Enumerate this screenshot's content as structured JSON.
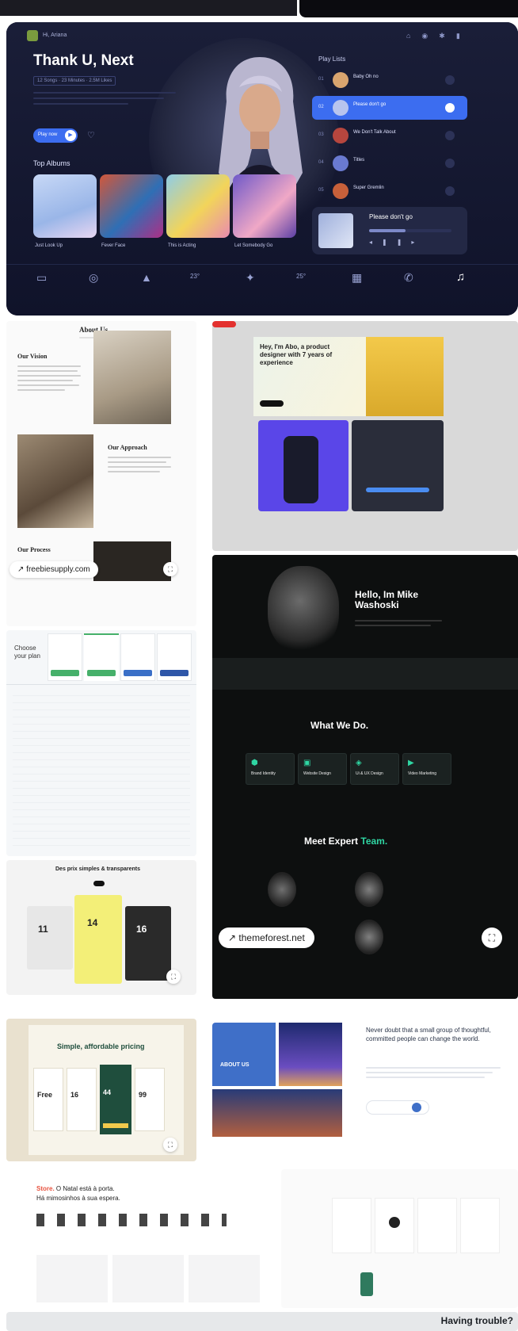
{
  "music": {
    "user_label": "Hi, Ariana",
    "title": "Thank U, Next",
    "meta": "12 Songs · 23 Minutes · 2.5M Likes",
    "play_label": "Play now",
    "top_albums_label": "Top Albums",
    "albums": [
      {
        "name": "Just Look Up"
      },
      {
        "name": "Fever Face"
      },
      {
        "name": "This is Acting"
      },
      {
        "name": "Let Somebody Go"
      }
    ],
    "playlists_label": "Play Lists",
    "playlist": [
      {
        "n": "01",
        "title": "Baby Oh no"
      },
      {
        "n": "02",
        "title": "Please don't go"
      },
      {
        "n": "03",
        "title": "We Don't Talk About"
      },
      {
        "n": "04",
        "title": "Titles"
      },
      {
        "n": "05",
        "title": "Super Gremlin"
      }
    ],
    "now_playing": "Please don't go",
    "temp_left": "23°",
    "temp_right": "25°"
  },
  "about": {
    "title": "About Us",
    "vision": "Our Vision",
    "approach": "Our Approach",
    "process": "Our Process",
    "source": "freebiesupply.com"
  },
  "pricing_table": {
    "heading": "Choose your plan"
  },
  "portfolio": {
    "headline": "Hey, I'm Abo, a product designer with 7 years of experience"
  },
  "agency": {
    "hello": "Hello, Im Mike Washoski",
    "what_we_do": "What We Do.",
    "services": [
      "Brand Identity",
      "Website Design",
      "Ui & UX Design",
      "Video Marketing"
    ],
    "meet_a": "Meet Expert",
    "meet_b": "Team.",
    "source": "themeforest.net"
  },
  "fr_pricing": {
    "title": "Des prix simples & transparents",
    "prices": [
      "11",
      "14",
      "16"
    ]
  },
  "afford": {
    "title": "Simple, affordable pricing",
    "prices": [
      "Free",
      "16",
      "44",
      "99"
    ]
  },
  "city": {
    "label": "ABOUT US",
    "quote": "Never doubt that a small group of thoughtful, committed people can change the world."
  },
  "store": {
    "headline_a": "Store.",
    "headline_b": "O Natal está à porta.",
    "headline_c": "Há mimosinhos à sua espera."
  },
  "footer": {
    "trouble": "Having trouble?"
  },
  "colors": {
    "accent_blue": "#3c6df0",
    "agency_green": "#2fd6a3",
    "portfolio_purple": "#5a46e8"
  }
}
